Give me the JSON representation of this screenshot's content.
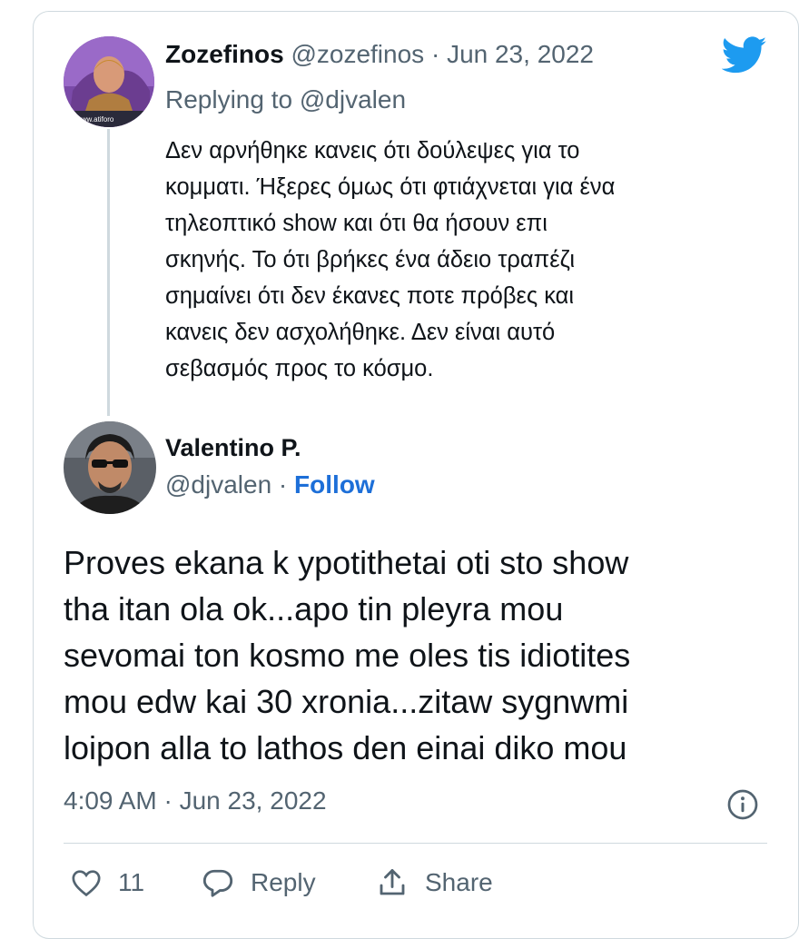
{
  "parent_tweet": {
    "name": "Zozefinos",
    "handle": "@zozefinos",
    "separator": " · ",
    "date": "Jun 23, 2022",
    "replying_to": "Replying to @djvalen",
    "avatar_caption": "www.atiforo",
    "text_lines": [
      "Δεν αρνήθηκε κανεις ότι δούλεψες για το",
      "κομματι. Ήξερες όμως ότι φτιάχνεται για ένα",
      "τηλεοπτικό show και ότι θα ήσουν επι",
      "σκηνής. Το ότι βρήκες ένα άδειο τραπέζι",
      "σημαίνει ότι δεν έκανες ποτε πρόβες και",
      "κανεις δεν ασχολήθηκε. Δεν είναι αυτό",
      "σεβασμός προς το κόσμο."
    ]
  },
  "main_tweet": {
    "name": "Valentino P.",
    "handle": "@djvalen",
    "separator": " · ",
    "follow_label": "Follow",
    "text_lines": [
      "Proves ekana k ypotithetai oti sto show",
      "tha itan ola ok...apo tin pleyra mou",
      "sevomai ton kosmo me oles tis idiotites",
      "mou edw kai 30 xronia...zitaw sygnwmi",
      "loipon alla to lathos den einai diko mou"
    ],
    "timestamp": "4:09 AM · Jun 23, 2022"
  },
  "actions": {
    "like_count": "11",
    "reply_label": "Reply",
    "share_label": "Share"
  },
  "icons": {
    "brand": "twitter-bird-icon",
    "info": "info-icon",
    "like": "heart-icon",
    "reply": "speech-bubble-icon",
    "share": "share-upload-icon"
  },
  "colors": {
    "brand_blue": "#1d9bf0",
    "follow_blue": "#1d6fd8",
    "muted_text": "#536471",
    "border": "#cfd9de"
  }
}
